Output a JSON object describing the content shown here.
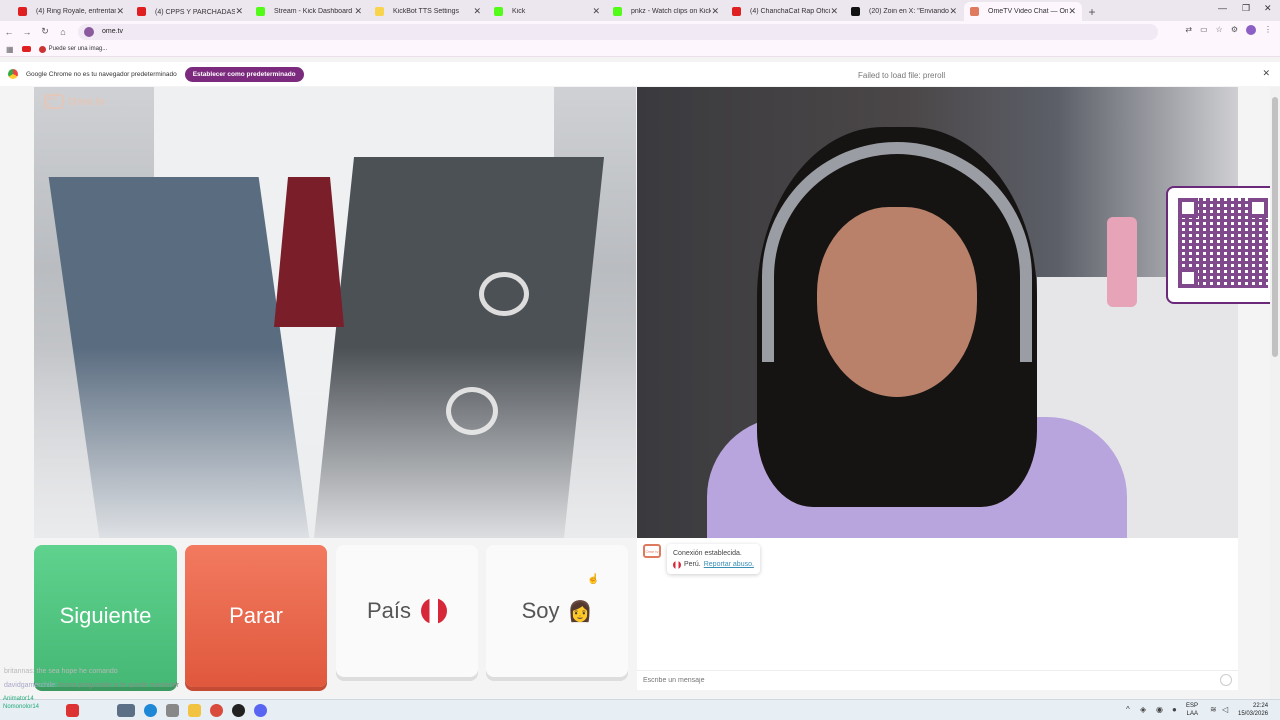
{
  "tabs": [
    {
      "title": "(4) Ring Royale, enfrentamient...",
      "fav_color": "#e02020"
    },
    {
      "title": "(4) CPPS Y PARCHADAS 🔥",
      "fav_color": "#e02020"
    },
    {
      "title": "Stream - Kick Dashboard",
      "fav_color": "#53fc18"
    },
    {
      "title": "KickBot TTS Settings",
      "fav_color": "#f7d44c"
    },
    {
      "title": "Kick",
      "fav_color": "#53fc18"
    },
    {
      "title": "pnkz - Watch clips on Kick",
      "fav_color": "#53fc18"
    },
    {
      "title": "(4) ChanchaCat Rap Oficial - Yo",
      "fav_color": "#e02020"
    },
    {
      "title": "(20) Zoin en X: \"Enviando invita",
      "fav_color": "#111111"
    },
    {
      "title": "OmeTV Video Chat — Ome",
      "fav_color": "#e07a5f",
      "active": true
    }
  ],
  "address": {
    "url": "ome.tv"
  },
  "bookmarks": [
    {
      "label": "Puede ser una imag..."
    }
  ],
  "infobar": {
    "message": "Google Chrome no es tu navegador predeterminado",
    "button": "Establecer como predeterminado",
    "failed": "Failed to load file: preroll"
  },
  "logo": {
    "text": "Ome.tv",
    "box": "Ome tv"
  },
  "controls": {
    "next": "Siguiente",
    "stop": "Parar",
    "country": "País",
    "gender": "Soy",
    "gender_emoji": "👩"
  },
  "chat": {
    "connected": "Conexión establecida.",
    "country": "Perú.",
    "report": "Reportar abuso.",
    "input_placeholder": "Escribe un mensaje"
  },
  "overlay": {
    "line1": "britannas: the sea hope he comando",
    "line2_user": "davidgamerchile:",
    "line2_text": "lmura preguntale si te quede mantener"
  },
  "taskbar": {
    "user1": "Animator14",
    "user2": "Nomonolor14",
    "lang": "ESP",
    "lang2": "LAA",
    "time": "22:24",
    "date": "15/03/2026"
  },
  "colors": {
    "accent": "#7b2a7e",
    "next": "#44b874",
    "stop": "#e0583d"
  }
}
